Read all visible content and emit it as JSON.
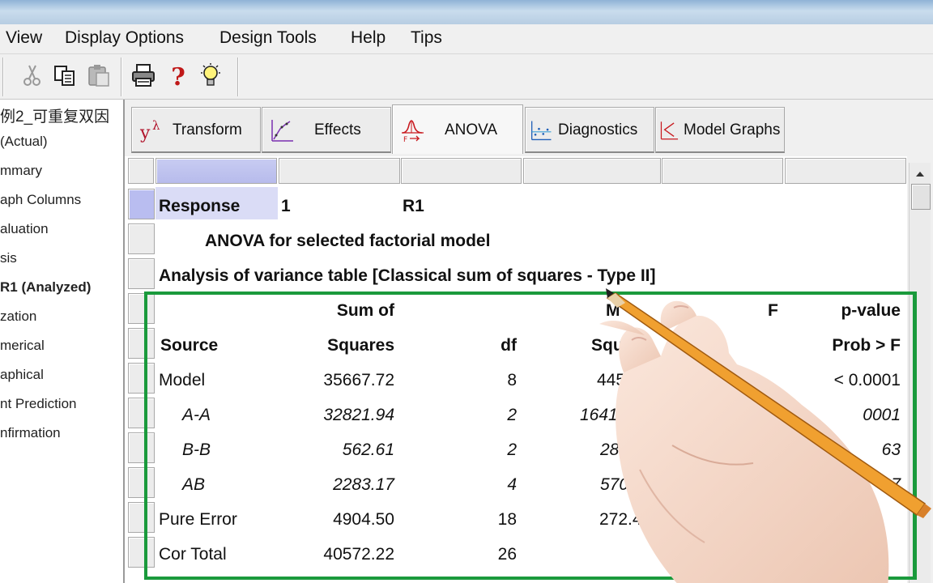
{
  "menu": {
    "items": [
      "View",
      "Display Options",
      "Design Tools",
      "Help",
      "Tips"
    ]
  },
  "toolbar": {
    "icons": [
      "cut-icon",
      "copy-icon",
      "paste-icon",
      "print-icon",
      "help-icon",
      "tip-bulb-icon"
    ]
  },
  "sidebar": {
    "items": [
      {
        "label": "例2_可重复双因",
        "bold": false
      },
      {
        "label": "(Actual)",
        "bold": false
      },
      {
        "label": "mmary",
        "bold": false
      },
      {
        "label": "aph Columns",
        "bold": false
      },
      {
        "label": "aluation",
        "bold": false
      },
      {
        "label": "sis",
        "bold": false
      },
      {
        "label": "R1 (Analyzed)",
        "bold": true
      },
      {
        "label": "zation",
        "bold": false
      },
      {
        "label": "merical",
        "bold": false
      },
      {
        "label": "aphical",
        "bold": false
      },
      {
        "label": "nt Prediction",
        "bold": false
      },
      {
        "label": "nfirmation",
        "bold": false
      }
    ]
  },
  "tabs": [
    {
      "label": "Transform",
      "icon": "transform-icon"
    },
    {
      "label": "Effects",
      "icon": "effects-icon"
    },
    {
      "label": "ANOVA",
      "icon": "anova-icon",
      "active": true
    },
    {
      "label": "Diagnostics",
      "icon": "diagnostics-icon"
    },
    {
      "label": "Model Graphs",
      "icon": "model-graphs-icon"
    }
  ],
  "report": {
    "response_label": "Response",
    "response_number": "1",
    "response_name": "R1",
    "title": "ANOVA for selected factorial model",
    "subtitle": "Analysis of variance table [Classical sum of squares - Type II]",
    "header_row1": {
      "sum": "Sum of",
      "mean": "M",
      "f": "F",
      "p": "p-value"
    },
    "header_row2": {
      "source": "Source",
      "squares": "Squares",
      "df": "df",
      "mean": "Squ",
      "p": "Prob > F"
    },
    "rows": [
      {
        "source": "Model",
        "ss": "35667.72",
        "df": "8",
        "ms": "445",
        "p": "< 0.0001",
        "italic": false
      },
      {
        "source": "A-A",
        "ss": "32821.94",
        "df": "2",
        "ms": "1641",
        "p": "0001",
        "italic": true
      },
      {
        "source": "B-B",
        "ss": "562.61",
        "df": "2",
        "ms": "281.",
        "p": "63",
        "italic": true
      },
      {
        "source": "AB",
        "ss": "2283.17",
        "df": "4",
        "ms": "570.7",
        "p": "7",
        "italic": true
      },
      {
        "source": "Pure Error",
        "ss": "4904.50",
        "df": "18",
        "ms": "272.47",
        "p": "",
        "italic": false
      },
      {
        "source": "Cor Total",
        "ss": "40572.22",
        "df": "26",
        "ms": "",
        "p": "",
        "italic": false
      }
    ]
  },
  "colors": {
    "highlight_box": "#1a9a3c",
    "selected_header": "#b9bdf0",
    "pencil": "#f0a030"
  }
}
